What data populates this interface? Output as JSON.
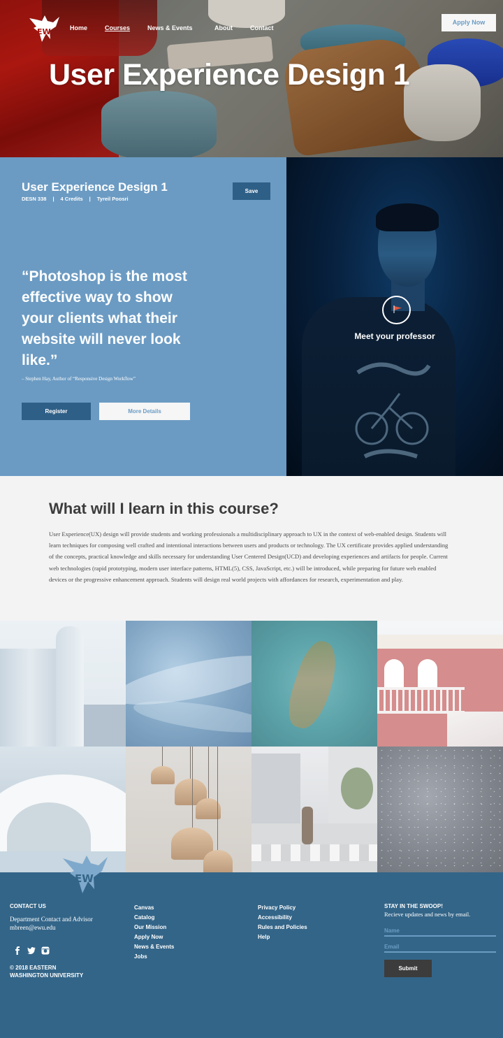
{
  "nav": {
    "items": [
      {
        "label": "Home"
      },
      {
        "label": "Courses"
      },
      {
        "label": "News & Events"
      },
      {
        "label": "About"
      },
      {
        "label": "Contact"
      }
    ],
    "apply_label": "Apply Now"
  },
  "hero": {
    "title": "User Experience Design 1"
  },
  "course": {
    "title": "User Experience Design 1",
    "code": "DESN 338",
    "credits": "4 Credits",
    "instructor": "Tyreil Poosri",
    "save_label": "Save",
    "quote": "“Photoshop is the most effective way to show your clients what their website will never look like.”",
    "quote_attribution": "– Stephen Hay, Author of “Responsive Design Workflow”",
    "register_label": "Register",
    "details_label": "More Details"
  },
  "professor": {
    "meet_label": "Meet your professor"
  },
  "learn": {
    "heading": "What will I learn in this course?",
    "body": "User Experience(UX) design will provide students and working professionals a multidisciplinary approach to UX in the context of web-enabled design. Students will learn techniques for composing well crafted and intentional interactions between users and products or technology. The UX certificate provides applied understanding of the concepts, practical knowledge and skills necessary for understanding User Centered Design(UCD) and developing experiences and artifacts for people. Current web technologies (rapid prototyping, modern user interface patterns, HTML(5), CSS, JavaScript, etc.) will be introduced, while preparing for future web enabled devices or the progressive enhancement approach. Students will design real world projects with affordances for research, experimentation and play."
  },
  "footer": {
    "contact_heading": "CONTACT US",
    "contact_role": "Department Contact and Advisor",
    "contact_email": "mbreen@ewu.edu",
    "copyright_line1": "© 2018 EASTERN",
    "copyright_line2": "WASHINGTON UNIVERSITY",
    "links_col1": [
      "Canvas",
      "Catalog",
      "Our Mission",
      "Apply Now",
      "News & Events",
      "Jobs"
    ],
    "links_col2": [
      "Privacy Policy",
      "Accessibility",
      "Rules and Policies",
      "Help"
    ],
    "newsletter_heading": "STAY IN THE SWOOP!",
    "newsletter_text": "Recieve updates and news by email.",
    "name_placeholder": "Name",
    "email_placeholder": "Email",
    "submit_label": "Submit",
    "social_icons": [
      "facebook-icon",
      "twitter-icon",
      "instagram-icon"
    ]
  },
  "colors": {
    "brand_blue": "#6b9bc3",
    "dark_blue": "#2e5f87",
    "footer_blue": "#336588",
    "hero_red": "#c21b13"
  }
}
